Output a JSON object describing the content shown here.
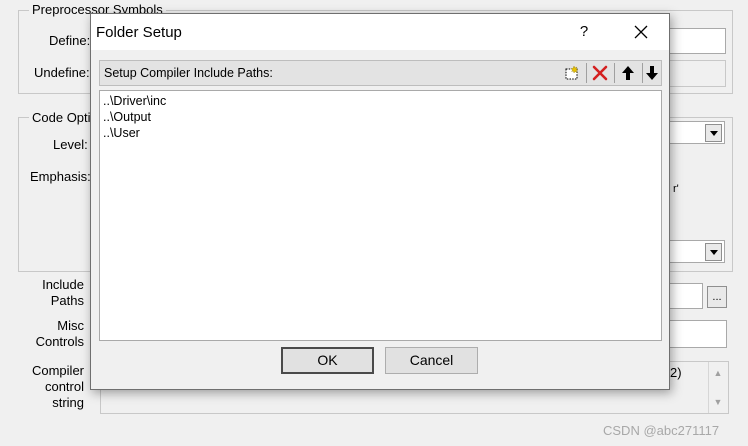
{
  "background_dialog": {
    "preprocessor_group": "Preprocessor Symbols",
    "define_label": "Define:",
    "undefine_label": "Undefine:",
    "code_opt_group": "Code Opti",
    "level_label": "Level:",
    "emphasis_label": "Emphasis:",
    "include_label_1": "Include",
    "include_label_2": "Paths",
    "misc_label_1": "Misc",
    "misc_label_2": "Controls",
    "compiler_label_1": "Compiler",
    "compiler_label_2": "control",
    "compiler_label_3": "string",
    "browse_label": "...",
    "right_fragment_1": "r'",
    "right_fragment_2": "2)"
  },
  "dialog": {
    "title": "Folder Setup",
    "help": "?",
    "list_caption": "Setup Compiler Include Paths:",
    "paths": [
      "..\\Driver\\inc",
      "..\\Output",
      "..\\User"
    ],
    "ok_label": "OK",
    "cancel_label": "Cancel"
  },
  "toolbar_icons": [
    "new-folder-icon",
    "delete-icon",
    "move-up-icon",
    "move-down-icon"
  ],
  "colors": {
    "delete_red": "#d42020",
    "watermark": "#a8a8a8"
  },
  "watermark": "CSDN @abc271117"
}
